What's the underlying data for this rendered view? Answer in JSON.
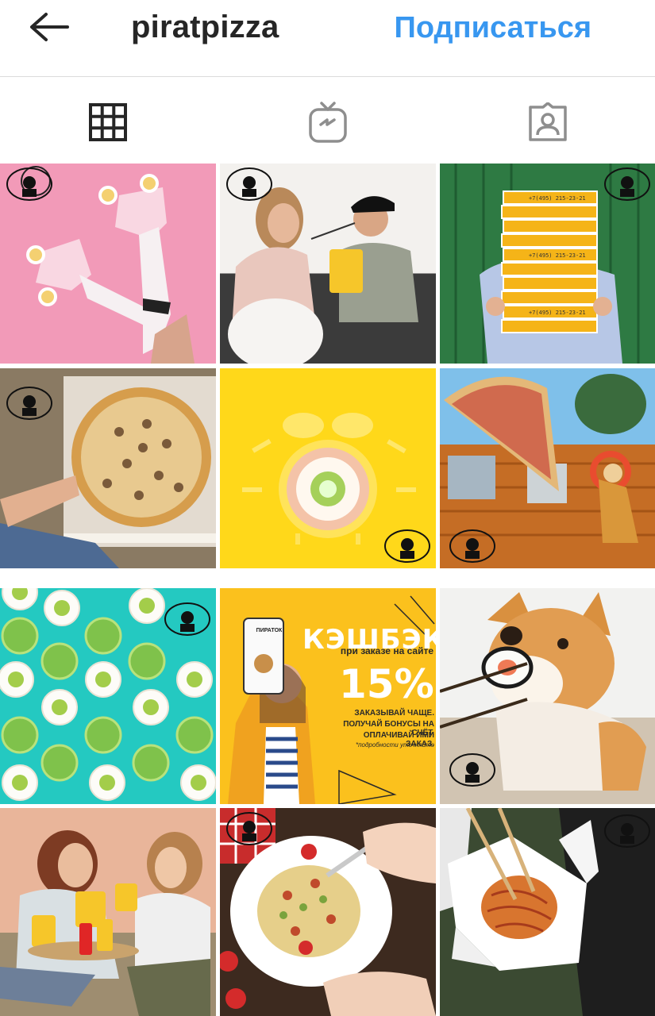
{
  "header": {
    "username": "piratpizza",
    "follow_label": "Подписаться"
  },
  "tabs": [
    {
      "icon": "grid-icon",
      "active": true
    },
    {
      "icon": "igtv-icon",
      "active": false
    },
    {
      "icon": "tagged-icon",
      "active": false
    }
  ],
  "posts": {
    "promo": {
      "title": "КЭШБЭК",
      "subtitle": "при заказе на сайте",
      "percent": "15%",
      "line1": "ЗАКАЗЫВАЙ ЧАЩЕ.",
      "line2": "ПОЛУЧАЙ БОНУСЫ НА СЧЁТ.",
      "line3": "ОПЛАЧИВАЙ ИМИ ЗАКАЗ.",
      "note": "*подробности уточняйте",
      "phone_label": "ПИРАТОК"
    },
    "pizza_box_phone": "+7(495) 215-23-21"
  },
  "colors": {
    "accent": "#3897f0",
    "text": "#262626",
    "divider": "#dbdbdb"
  }
}
